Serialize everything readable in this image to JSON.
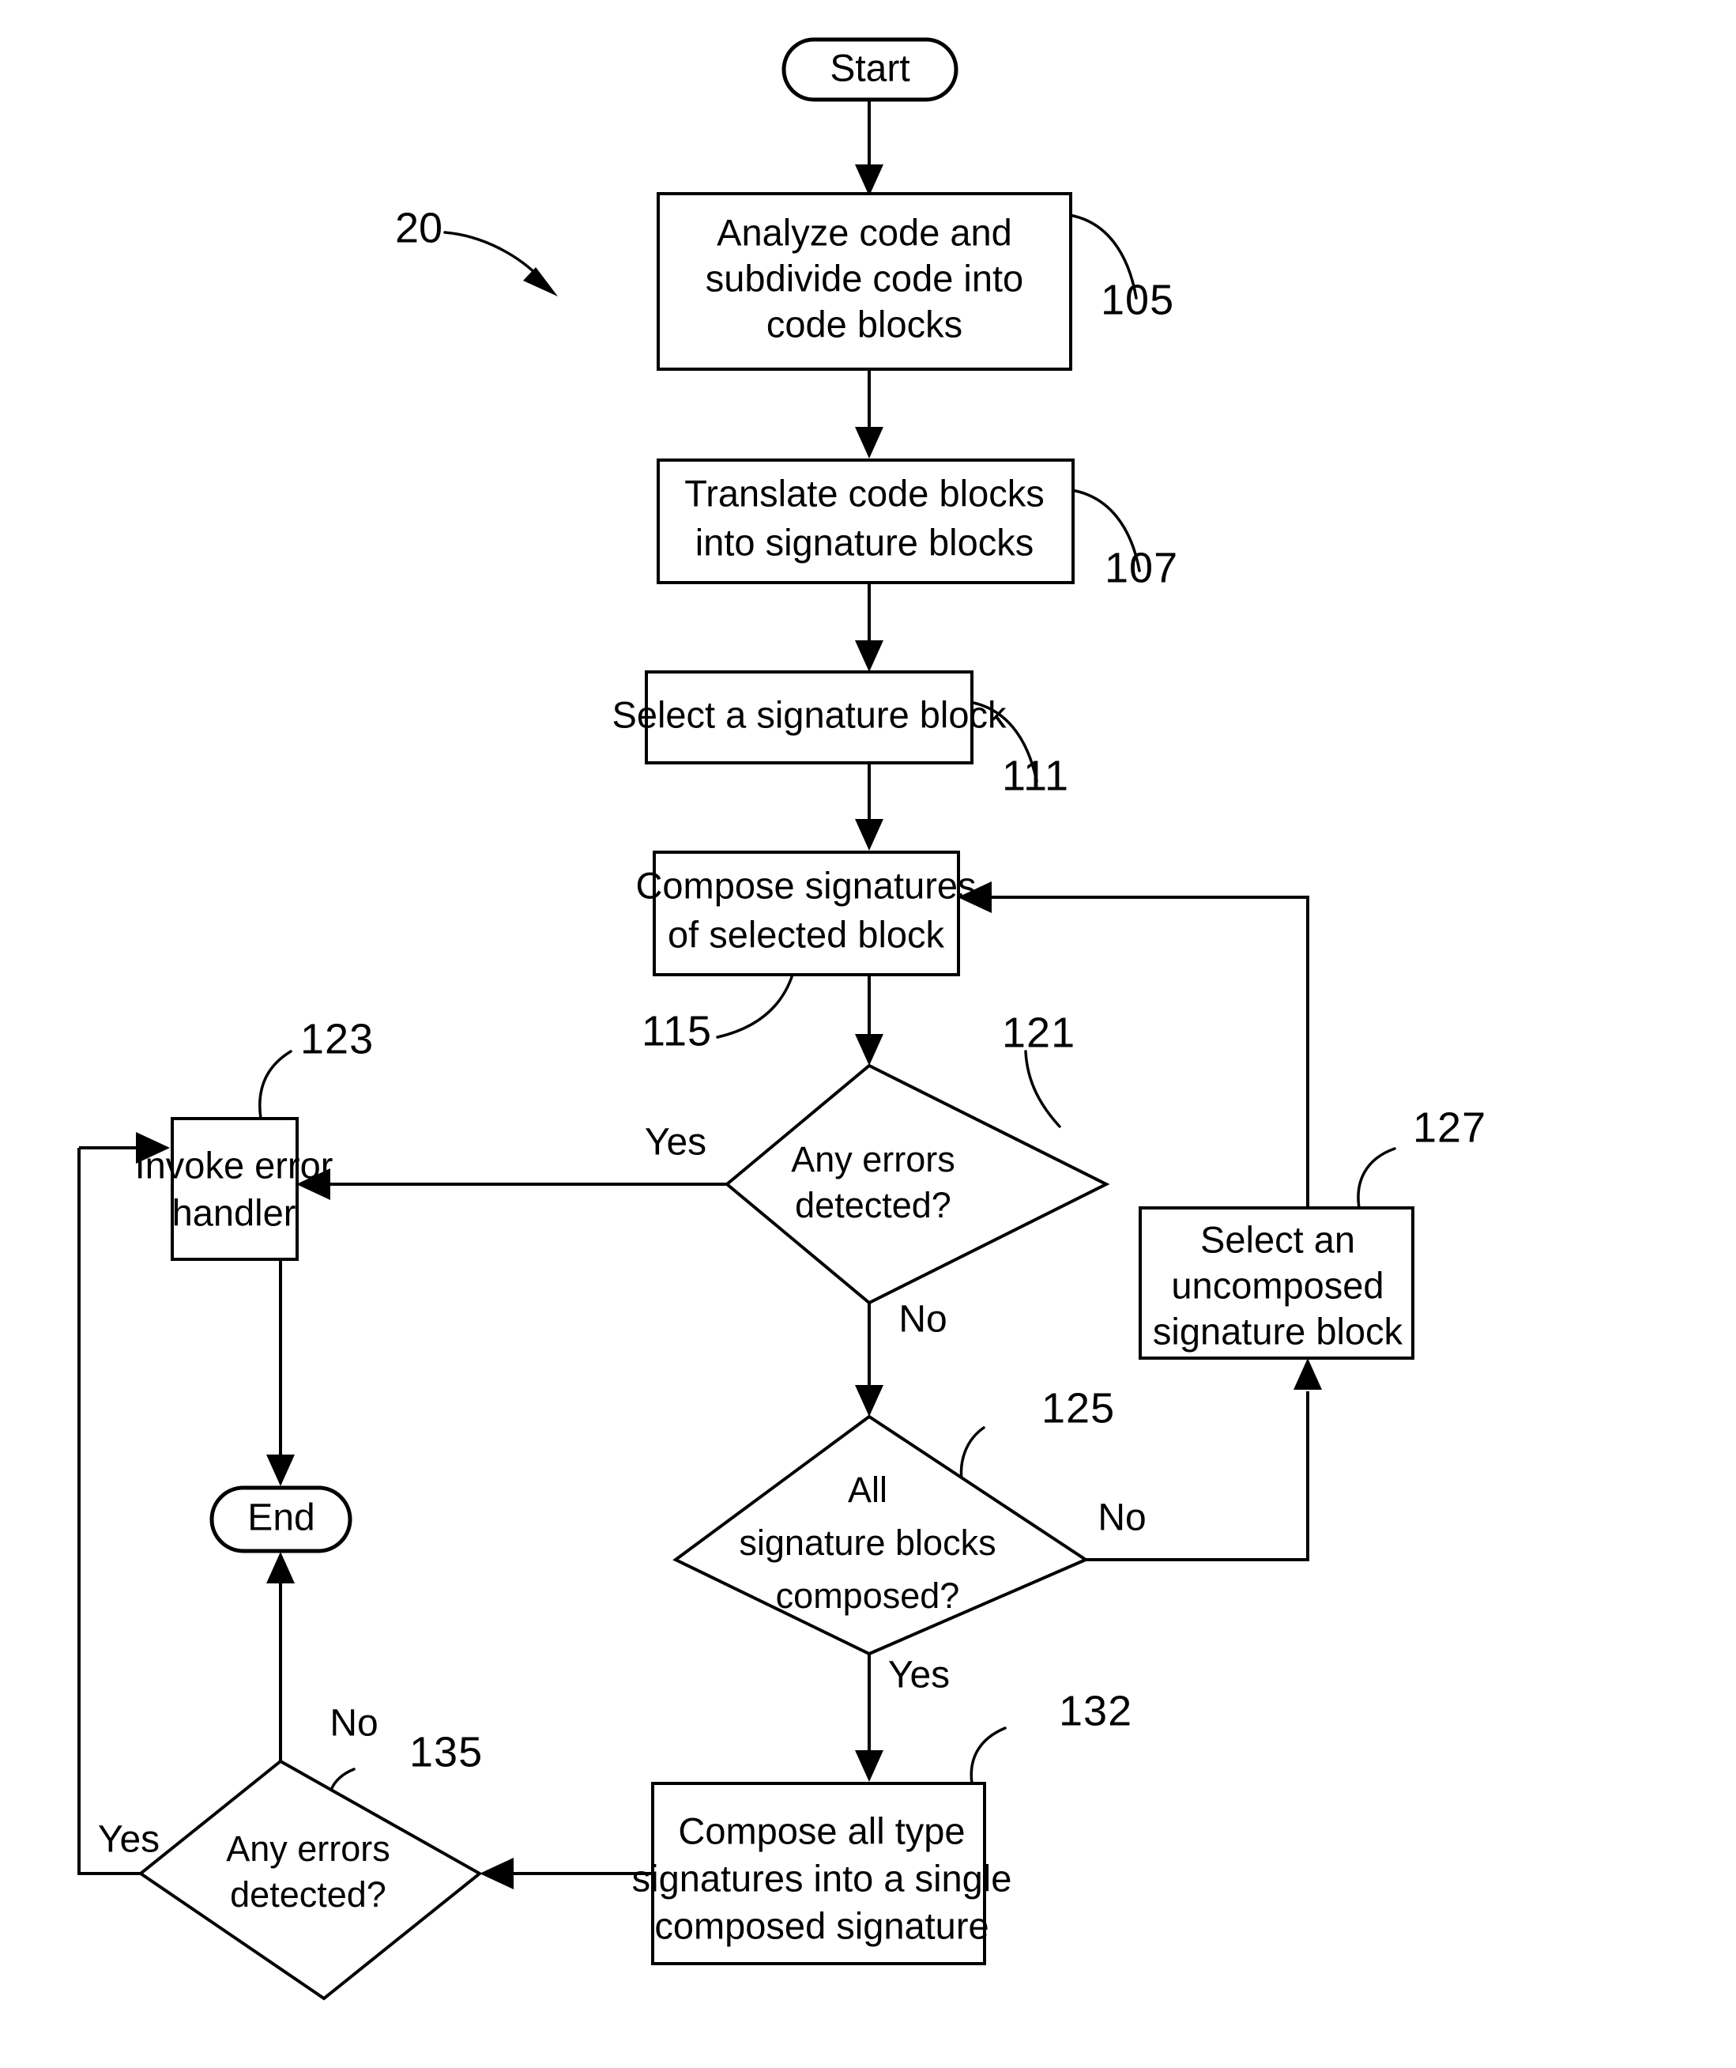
{
  "figure": {
    "label": "20",
    "type": "process-flowchart",
    "description": "Flowchart for composing signatures of code blocks"
  },
  "nodes": {
    "start": {
      "id": "start",
      "shape": "terminator",
      "label": "Start"
    },
    "end": {
      "id": "end",
      "shape": "terminator",
      "label": "End"
    },
    "step_105": {
      "ref": "105",
      "shape": "process",
      "line1": "Analyze code and",
      "line2": "subdivide code into",
      "line3": "code blocks"
    },
    "step_107": {
      "ref": "107",
      "shape": "process",
      "line1": "Translate code blocks",
      "line2": "into signature blocks"
    },
    "step_111": {
      "ref": "111",
      "shape": "process",
      "line1": "Select a signature block"
    },
    "step_115": {
      "ref": "115",
      "shape": "process",
      "line1": "Compose signatures",
      "line2": "of selected block"
    },
    "decision_121": {
      "ref": "121",
      "shape": "decision",
      "line1": "Any errors",
      "line2": "detected?",
      "branch_yes": "Yes",
      "branch_no": "No"
    },
    "step_123": {
      "ref": "123",
      "shape": "process",
      "line1": "Invoke error",
      "line2": "handler"
    },
    "decision_125": {
      "ref": "125",
      "shape": "decision",
      "line1": "All",
      "line2": "signature blocks",
      "line3": "composed?",
      "branch_yes": "Yes",
      "branch_no": "No"
    },
    "step_127": {
      "ref": "127",
      "shape": "process",
      "line1": "Select an",
      "line2": "uncomposed",
      "line3": "signature block"
    },
    "step_132": {
      "ref": "132",
      "shape": "process",
      "line1": "Compose all type",
      "line2": "signatures into a single",
      "line3": "composed signature"
    },
    "decision_135": {
      "ref": "135",
      "shape": "decision",
      "line1": "Any errors",
      "line2": "detected?",
      "branch_yes": "Yes",
      "branch_no": "No"
    }
  },
  "colors": {
    "stroke": "#000000",
    "fill": "#ffffff",
    "background": "#ffffff"
  }
}
